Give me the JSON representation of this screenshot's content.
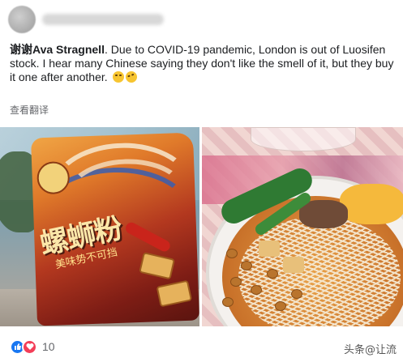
{
  "post": {
    "mention": "谢谢Ava Stragnell",
    "text": ". Due to COVID-19 pandemic, London is out of Luosifen stock. I hear many Chinese saying they don't like the smell of it, but they buy it one after another.",
    "emojis": [
      "grinning-sweat-emoji",
      "rolling-laughing-emoji"
    ],
    "translate_label": "查看翻译"
  },
  "photos": [
    {
      "name": "noodle-package-photo",
      "brand_text": "螺蛳粉",
      "tagline": "美味势不可挡"
    },
    {
      "name": "noodle-bowl-photo"
    }
  ],
  "footer": {
    "reactions": [
      "like-icon",
      "love-icon"
    ],
    "reaction_count": "10"
  },
  "watermark": "头条@让流",
  "colors": {
    "like": "#1877f2",
    "love": "#f33e58",
    "secondary_text": "#65676b"
  }
}
